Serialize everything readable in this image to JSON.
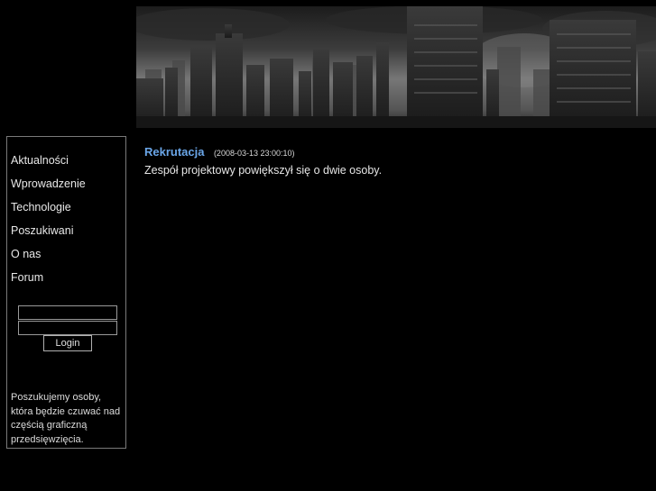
{
  "banner": {
    "icon": "city-ruins-banner"
  },
  "sidebar": {
    "menu": [
      {
        "label": "Aktualności"
      },
      {
        "label": "Wprowadzenie"
      },
      {
        "label": "Technologie"
      },
      {
        "label": "Poszukiwani"
      },
      {
        "label": "O nas"
      },
      {
        "label": "Forum"
      }
    ],
    "login": {
      "username_value": "",
      "password_value": "",
      "button_label": "Login"
    },
    "notice": "Poszukujemy osoby, która będzie czuwać nad częścią graficzną przedsięwzięcia."
  },
  "post": {
    "title": "Rekrutacja",
    "date": "(2008-03-13 23:00:10)",
    "body": "Zespół projektowy powiększył się o dwie osoby."
  },
  "colors": {
    "background": "#000000",
    "link": "#6aa6e8",
    "border": "#7a7a7a"
  }
}
